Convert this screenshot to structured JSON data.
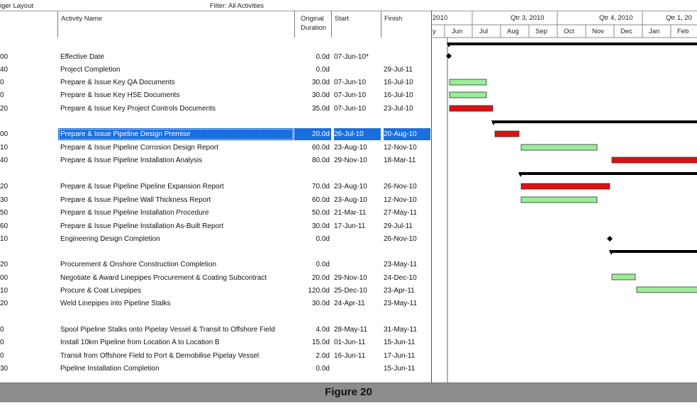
{
  "header": {
    "layout_label": "iger Layout",
    "filter_label": "Filter: All Activities"
  },
  "columns": {
    "activity_name": "Activity Name",
    "duration_line1": "Original",
    "duration_line2": "Duration",
    "start": "Start",
    "finish": "Finish"
  },
  "timescale": {
    "quarters": [
      "2010",
      "Qtr 3, 2010",
      "Qtr 4, 2010",
      "Qtr 1, 20"
    ],
    "months": [
      "y",
      "Jun",
      "Jul",
      "Aug",
      "Sep",
      "Oct",
      "Nov",
      "Dec",
      "Jan",
      "Feb"
    ]
  },
  "activities": [
    {
      "id": "00",
      "name": "Effective Date",
      "duration": "0.0d",
      "start": "07-Jun-10*",
      "finish": ""
    },
    {
      "id": "40",
      "name": "Project Completion",
      "duration": "0.0d",
      "start": "",
      "finish": "29-Jul-11"
    },
    {
      "id": "0",
      "name": "Prepare & Issue Key QA Documents",
      "duration": "30.0d",
      "start": "07-Jun-10",
      "finish": "16-Jul-10"
    },
    {
      "id": "0",
      "name": "Prepare & Issue Key HSE Documents",
      "duration": "30.0d",
      "start": "07-Jun-10",
      "finish": "16-Jul-10"
    },
    {
      "id": "20",
      "name": "Prepare & Issue Key Project Controls Documents",
      "duration": "35.0d",
      "start": "07-Jun-10",
      "finish": "23-Jul-10"
    },
    {
      "id": "00",
      "name": "Prepare & Issue Pipeline Design Premise",
      "duration": "20.0d",
      "start": "26-Jul-10",
      "finish": "20-Aug-10"
    },
    {
      "id": "10",
      "name": "Prepare & Issue Pipeline Corrosion Design Report",
      "duration": "60.0d",
      "start": "23-Aug-10",
      "finish": "12-Nov-10"
    },
    {
      "id": "40",
      "name": "Prepare & Issue Pipeline Installation Analysis",
      "duration": "80.0d",
      "start": "29-Nov-10",
      "finish": "18-Mar-11"
    },
    {
      "id": "20",
      "name": "Prepare & Issue Pipeline Pipeline Expansion Report",
      "duration": "70.0d",
      "start": "23-Aug-10",
      "finish": "26-Nov-10"
    },
    {
      "id": "30",
      "name": "Prepare & Issue Pipeline Wall Thickness Report",
      "duration": "60.0d",
      "start": "23-Aug-10",
      "finish": "12-Nov-10"
    },
    {
      "id": "50",
      "name": "Prepare & Issue Pipeline Installation Procedure",
      "duration": "50.0d",
      "start": "21-Mar-11",
      "finish": "27-May-11"
    },
    {
      "id": "60",
      "name": "Prepare & Issue Pipeline Installation As-Built Report",
      "duration": "30.0d",
      "start": "17-Jun-11",
      "finish": "29-Jul-11"
    },
    {
      "id": "10",
      "name": "Engineering Design Completion",
      "duration": "0.0d",
      "start": "",
      "finish": "26-Nov-10"
    },
    {
      "id": "20",
      "name": "Procurement & Onshore Construction Completion",
      "duration": "0.0d",
      "start": "",
      "finish": "23-May-11"
    },
    {
      "id": "00",
      "name": "Negotiate & Award Linepipes Procurement & Coating Subcontract",
      "duration": "20.0d",
      "start": "29-Nov-10",
      "finish": "24-Dec-10"
    },
    {
      "id": "10",
      "name": "Procure & Coat Linepipes",
      "duration": "120.0d",
      "start": "25-Dec-10",
      "finish": "23-Apr-11"
    },
    {
      "id": "20",
      "name": "Weld Linepipes into Pipeline Stalks",
      "duration": "30.0d",
      "start": "24-Apr-11",
      "finish": "23-May-11"
    },
    {
      "id": "0",
      "name": "Spool Pipeline Stalks onto Pipelay Vessel & Transit to Offshore Field",
      "duration": "4.0d",
      "start": "28-May-11",
      "finish": "31-May-11"
    },
    {
      "id": "0",
      "name": "Install 10km Pipeline from Location A to Location B",
      "duration": "15.0d",
      "start": "01-Jun-11",
      "finish": "15-Jun-11"
    },
    {
      "id": "0",
      "name": "Transit from Offshore Field to Port & Demobilise Pipelay Vessel",
      "duration": "2.0d",
      "start": "16-Jun-11",
      "finish": "17-Jun-11"
    },
    {
      "id": "30",
      "name": "Pipeline Installation Completion",
      "duration": "0.0d",
      "start": "",
      "finish": "15-Jun-11"
    }
  ],
  "colors": {
    "critical": "#dd1111",
    "noncritical": "#99ee99",
    "summary": "#000000",
    "selection": "#1a6fe0",
    "footer": "#8c8c8c"
  },
  "footer": {
    "caption": "Figure 20"
  }
}
